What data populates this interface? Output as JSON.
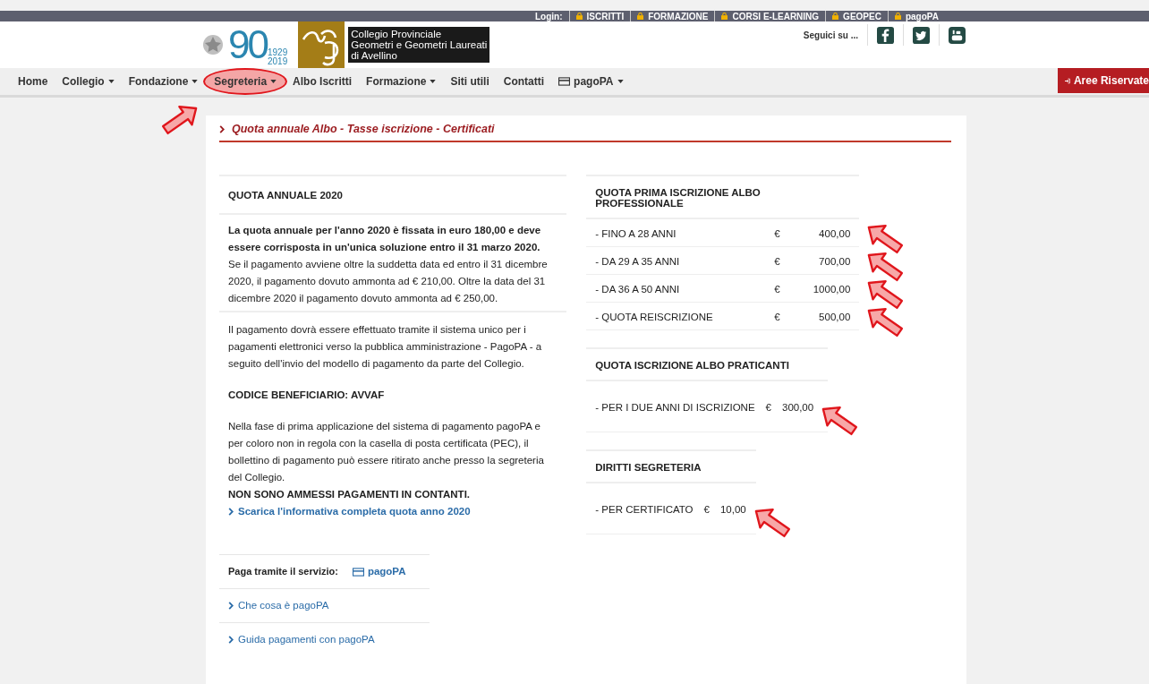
{
  "top_bar": {
    "label": "Login:",
    "links": [
      "ISCRITTI",
      "FORMAZIONE",
      "CORSI E-LEARNING",
      "GEOPEC",
      "pagoPA"
    ]
  },
  "header": {
    "logo_90": "90",
    "logo_years": [
      "1929",
      "2019"
    ],
    "org_name": [
      "Collegio Provinciale",
      "Geometri e Geometri Laureati",
      "di Avellino"
    ],
    "follow_label": "Seguici su ..."
  },
  "nav": {
    "items": [
      {
        "label": "Home",
        "dropdown": false,
        "circled": false,
        "icon": false
      },
      {
        "label": "Collegio",
        "dropdown": true,
        "circled": false,
        "icon": false
      },
      {
        "label": "Fondazione",
        "dropdown": true,
        "circled": false,
        "icon": false
      },
      {
        "label": "Segreteria",
        "dropdown": true,
        "circled": true,
        "icon": false
      },
      {
        "label": "Albo Iscritti",
        "dropdown": false,
        "circled": false,
        "icon": false
      },
      {
        "label": "Formazione",
        "dropdown": true,
        "circled": false,
        "icon": false
      },
      {
        "label": "Siti utili",
        "dropdown": false,
        "circled": false,
        "icon": false
      },
      {
        "label": "Contatti",
        "dropdown": false,
        "circled": false,
        "icon": false
      },
      {
        "label": "pagoPA",
        "dropdown": true,
        "circled": false,
        "icon": true
      }
    ],
    "reserved_button": "Aree Riservate"
  },
  "page_title": "Quota annuale Albo - Tasse iscrizione - Certificati",
  "left": {
    "heading": "QUOTA ANNUALE 2020",
    "intro_bold": "La quota annuale per l'anno 2020 è fissata in euro 180,00 e deve essere corrisposta in un'unica soluzione entro il 31 marzo 2020.",
    "intro_text": "Se il pagamento avviene oltre la suddetta data ed entro il 31 dicembre 2020, il pagamento dovuto ammonta ad € 210,00. Oltre la data del 31 dicembre 2020 il pagamento dovuto ammonta ad € 250,00.",
    "payment_text": "Il pagamento dovrà essere effettuato tramite il sistema unico per i pagamenti elettronici verso la pubblica amministrazione - PagoPA - a seguito dell'invio del modello di pagamento da parte del Collegio.",
    "code": "CODICE BENEFICIARIO: AVVAF",
    "note_text": "Nella fase di prima applicazione del sistema di pagamento pagoPA e per coloro non in regola con la casella di posta certificata (PEC), il bollettino di pagamento può essere ritirato anche presso la segreteria del Collegio.",
    "warning": "NON SONO AMMESSI PAGAMENTI IN CONTANTI.",
    "download_link": "Scarica l'informativa completa quota anno 2020",
    "pay_label": "Paga tramite il servizio:",
    "pay_link": "pagoPA",
    "links": [
      "Che cosa è pagoPA",
      "Guida pagamenti con pagoPA"
    ]
  },
  "fee_tables": [
    {
      "heading": "QUOTA PRIMA ISCRIZIONE ALBO PROFESSIONALE",
      "rows": [
        {
          "label": "- FINO A 28 ANNI",
          "currency": "€",
          "amount": "400,00",
          "arrowed": true
        },
        {
          "label": "- DA 29 A 35 ANNI",
          "currency": "€",
          "amount": "700,00",
          "arrowed": true
        },
        {
          "label": "- DA 36 A 50 ANNI",
          "currency": "€",
          "amount": "1000,00",
          "arrowed": true
        },
        {
          "label": "- QUOTA REISCRIZIONE",
          "currency": "€",
          "amount": "500,00",
          "arrowed": true
        }
      ]
    },
    {
      "heading": "QUOTA ISCRIZIONE ALBO PRATICANTI",
      "rows": [
        {
          "label": "- PER I DUE ANNI DI ISCRIZIONE",
          "currency": "€",
          "amount": "300,00",
          "arrowed": true
        }
      ]
    },
    {
      "heading": "DIRITTI SEGRETERIA",
      "rows": [
        {
          "label": "- PER CERTIFICATO",
          "currency": "€",
          "amount": "10,00",
          "arrowed": true
        }
      ]
    }
  ]
}
